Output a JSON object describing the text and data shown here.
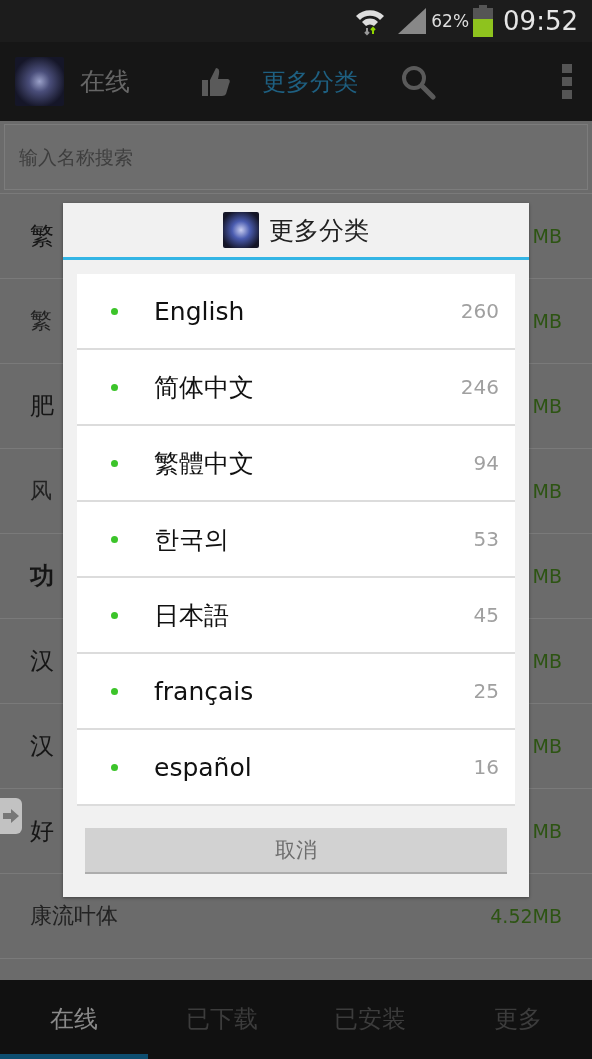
{
  "status_bar": {
    "battery": "62%",
    "time": "09:52"
  },
  "action_bar": {
    "title": "在线",
    "category_button": {
      "label": "更多分类",
      "active": true
    }
  },
  "search": {
    "placeholder": "输入名称搜索"
  },
  "font_list": [
    {
      "name": "繁",
      "size": "MB",
      "kind": "plain"
    },
    {
      "name": "繁",
      "size": "MB",
      "kind": "light"
    },
    {
      "name": "肥",
      "size": "MB",
      "kind": "plain"
    },
    {
      "name": "风",
      "size": "MB",
      "kind": "light"
    },
    {
      "name": "功",
      "size": "MB",
      "kind": "bold"
    },
    {
      "name": "汉",
      "size": "MB",
      "kind": "plain"
    },
    {
      "name": "汉",
      "size": "MB",
      "kind": "plain"
    },
    {
      "name": "好",
      "size": "MB",
      "kind": "plain"
    },
    {
      "name": "康流叶体",
      "size": "4.52MB",
      "kind": "light"
    }
  ],
  "dialog": {
    "title": "更多分类",
    "items": [
      {
        "label": "English",
        "count": "260"
      },
      {
        "label": "简体中文",
        "count": "246"
      },
      {
        "label": "繁體中文",
        "count": "94"
      },
      {
        "label": "한국의",
        "count": "53"
      },
      {
        "label": "日本語",
        "count": "45"
      },
      {
        "label": "français",
        "count": "25"
      },
      {
        "label": "español",
        "count": "16"
      }
    ],
    "cancel": "取消"
  },
  "bottom_tabs": [
    {
      "label": "在线",
      "selected": true
    },
    {
      "label": "已下载",
      "selected": false
    },
    {
      "label": "已安装",
      "selected": false
    },
    {
      "label": "更多",
      "selected": false
    }
  ]
}
